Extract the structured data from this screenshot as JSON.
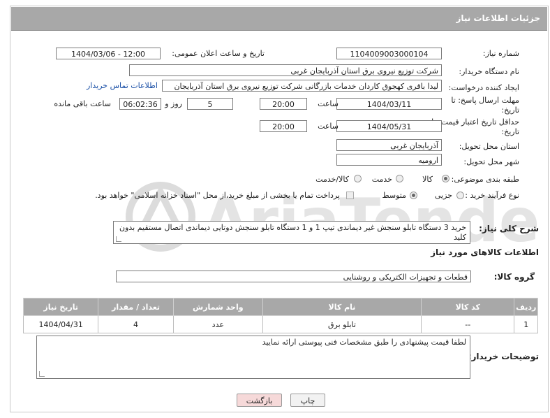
{
  "page_title": "جزئیات اطلاعات نیاز",
  "fields": {
    "need_number_label": "شماره نیاز:",
    "need_number": "1104009003000104",
    "announce_label": "تاریخ و ساعت اعلان عمومی:",
    "announce_value": "1404/03/06 - 12:00",
    "buyer_org_label": "نام دستگاه خریدار:",
    "buyer_org": "شرکت توزیع نیروی برق استان آذربایجان غربی",
    "creator_label": "ایجاد کننده درخواست:",
    "creator": "لیدا باقری کهجوق کاردان خدمات بازرگانی شرکت توزیع نیروی برق استان آذربایجان",
    "contact_link": "اطلاعات تماس خریدار",
    "deadline_label": "مهلت ارسال پاسخ: تا تاریخ:",
    "deadline_date": "1404/03/11",
    "time_label": "ساعت",
    "deadline_time": "20:00",
    "days_value": "5",
    "days_label": "روز و",
    "remaining_time": "06:02:36",
    "remaining_label": "ساعت باقی مانده",
    "validity_label": "حداقل تاریخ اعتبار قیمت: تا تاریخ:",
    "validity_date": "1404/05/31",
    "validity_time": "20:00",
    "province_label": "استان محل تحویل:",
    "province": "آذربایجان غربی",
    "city_label": "شهر محل تحویل:",
    "city": "ارومیه",
    "category_label": "طبقه بندی موضوعی:",
    "category_options": [
      "کالا",
      "خدمت",
      "کالا/خدمت"
    ],
    "process_label": "نوع فرآیند خرید :",
    "process_options": [
      "جزیی",
      "متوسط"
    ],
    "payment_note": "پرداخت تمام یا بخشی از مبلغ خرید،از محل \"اسناد خزانه اسلامی\" خواهد بود."
  },
  "description": {
    "label": "شرح کلی نیاز:",
    "text": "خرید 3 دستگاه تابلو سنجش غیر دیماندی تیپ 1 و  1 دستگاه تابلو سنجش دوتایی دیماندی اتصال مستقیم بدون کلید"
  },
  "goods_section_title": "اطلاعات کالاهای مورد نیاز",
  "goods_group_label": "گروه کالا:",
  "goods_group": "قطعات و تجهیزات الکتریکی و روشنایی",
  "table": {
    "headers": [
      "ردیف",
      "کد کالا",
      "نام کالا",
      "واحد شمارش",
      "تعداد / مقدار",
      "تاریخ نیاز"
    ],
    "rows": [
      [
        "1",
        "--",
        "تابلو برق",
        "عدد",
        "4",
        "1404/04/31"
      ]
    ]
  },
  "buyer_notes": {
    "label": "توضیحات خریدار:",
    "text": "لطفا قیمت پیشنهادی را طبق مشخصات فنی پیوستی ارائه نمایید"
  },
  "buttons": {
    "print": "چاپ",
    "back": "بازگشت"
  },
  "colors": {
    "header_bg": "#a8a8a8",
    "link": "#1a4fa6",
    "back_button_bg": "#f6d9d9",
    "watermark": "#d9d9d9"
  },
  "watermark_icon": "aria-tender-watermark"
}
